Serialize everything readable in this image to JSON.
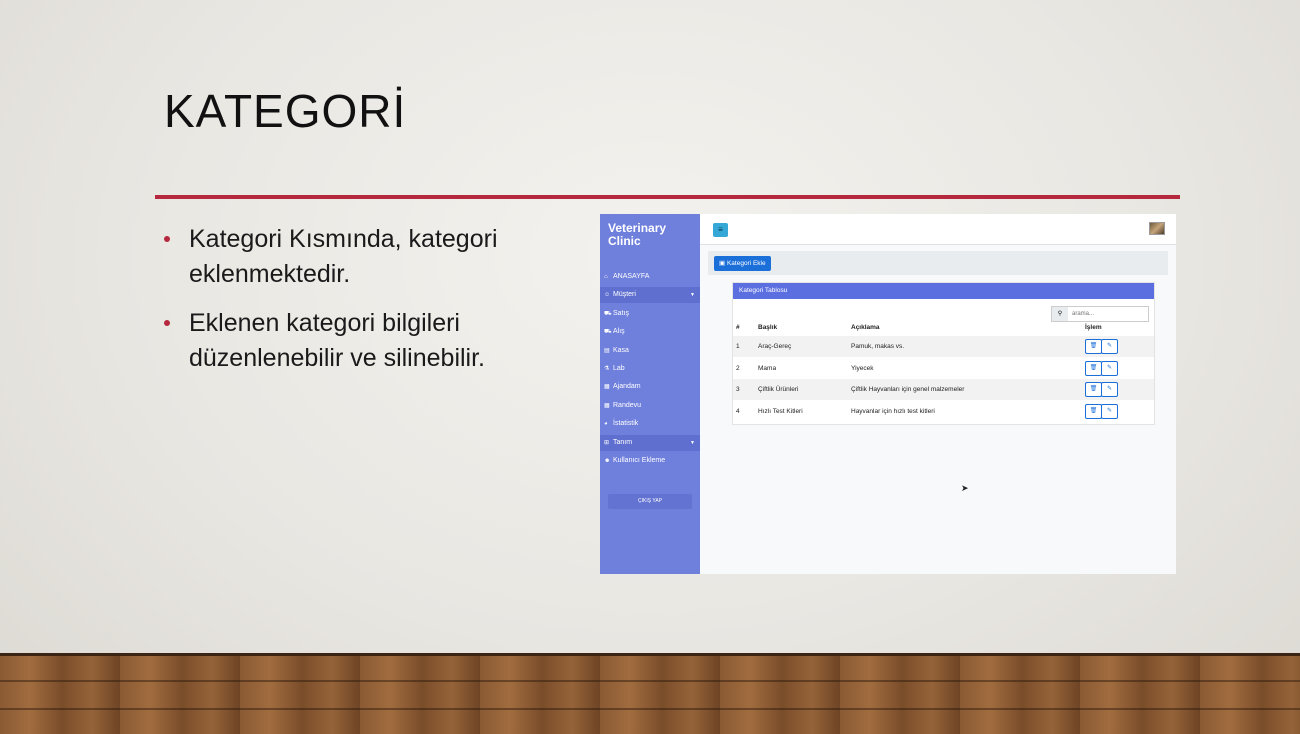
{
  "slide": {
    "title": "KATEGORİ",
    "bullets": [
      "Kategori Kısmında, kategori eklenmektedir.",
      "Eklenen kategori bilgileri düzenlenebilir ve silinebilir."
    ],
    "accent_color": "#b5283e"
  },
  "app": {
    "brand": "Veterinary Clinic",
    "sidebar_color": "#6f7fdc",
    "nav": [
      {
        "label": "ANASAYFA",
        "icon": "home-icon",
        "glyph": "⌂"
      },
      {
        "label": "Müşteri",
        "icon": "users-icon",
        "glyph": "☺",
        "has_submenu": true
      },
      {
        "label": "Satış",
        "icon": "truck-icon",
        "glyph": "⛟"
      },
      {
        "label": "Alış",
        "icon": "truck-icon",
        "glyph": "⛟"
      },
      {
        "label": "Kasa",
        "icon": "money-icon",
        "glyph": "▤"
      },
      {
        "label": "Lab",
        "icon": "flask-icon",
        "glyph": "⚗"
      },
      {
        "label": "Ajandam",
        "icon": "calendar-icon",
        "glyph": "▦"
      },
      {
        "label": "Randevu",
        "icon": "calendar-icon",
        "glyph": "▦"
      },
      {
        "label": "İstatistik",
        "icon": "chart-pie-icon",
        "glyph": "◕"
      },
      {
        "label": "Tanım",
        "icon": "grid-icon",
        "glyph": "⊞",
        "has_submenu": true
      },
      {
        "label": "Kullanıcı Ekleme",
        "icon": "user-plus-icon",
        "glyph": "☻"
      }
    ],
    "logout_label": "ÇIKIŞ YAP",
    "add_button_label": "Kategori Ekle",
    "table_title": "Kategori Tablosu",
    "search_placeholder": "arama...",
    "columns": [
      "#",
      "Başlık",
      "Açıklama",
      "İşlem"
    ],
    "rows": [
      {
        "id": "1",
        "title": "Araç-Gereç",
        "desc": "Pamuk, makas vs."
      },
      {
        "id": "2",
        "title": "Mama",
        "desc": "Yiyecek"
      },
      {
        "id": "3",
        "title": "Çiftlik Ürünleri",
        "desc": "Çiftlik Hayvanları için genel malzemeler"
      },
      {
        "id": "4",
        "title": "Hızlı Test Kitleri",
        "desc": "Hayvanlar için hızlı test kitleri"
      }
    ]
  }
}
